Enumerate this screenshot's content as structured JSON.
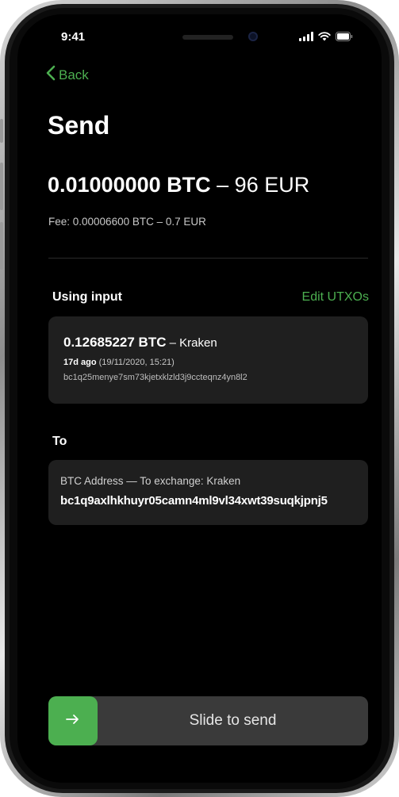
{
  "status_bar": {
    "time": "9:41"
  },
  "nav": {
    "back_label": "Back"
  },
  "page": {
    "title": "Send"
  },
  "amount": {
    "btc": "0.01000000 BTC",
    "separator": " – ",
    "fiat": "96 EUR"
  },
  "fee": {
    "text": "Fee:  0.00006600 BTC – 0.7 EUR"
  },
  "input_section": {
    "label": "Using input",
    "edit_label": "Edit UTXOs",
    "utxo": {
      "amount": "0.12685227 BTC",
      "source": " – Kraken",
      "age": "17d ago",
      "date": " (19/11/2020, 15:21)",
      "address": "bc1q25menye7sm73kjetxklzld3j9ccteqnz4yn8l2"
    }
  },
  "to_section": {
    "label": "To",
    "recipient_label": "BTC Address — To exchange: Kraken",
    "address": "bc1q9axlhkhuyr05camn4ml9vl34xwt39suqkjpnj5"
  },
  "slider": {
    "arrow": "→",
    "label": "Slide to send"
  },
  "colors": {
    "accent": "#4caf50",
    "background": "#000000",
    "card": "#1f1f1f",
    "slider_track": "#3a3a3a"
  },
  "icons": [
    "chevron-left-icon",
    "signal-icon",
    "wifi-icon",
    "battery-icon",
    "arrow-right-icon"
  ]
}
